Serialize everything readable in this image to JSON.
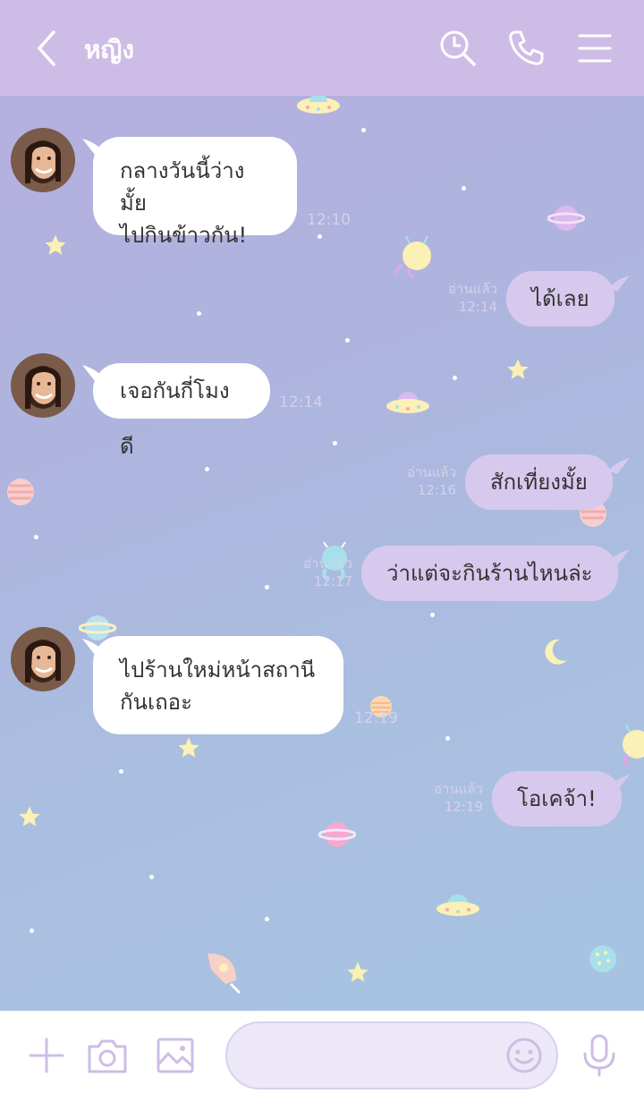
{
  "header": {
    "title": "หญิง"
  },
  "messages": [
    {
      "side": "in",
      "lines": [
        "กลางวันนี้ว่างมั้ย",
        "ไปกินข้าวกัน!"
      ],
      "time": "12:10"
    },
    {
      "side": "out",
      "text": "ได้เลย",
      "read": "อ่านแล้ว",
      "time": "12:14"
    },
    {
      "side": "in",
      "lines": [
        "เจอกันกี่โมงดี"
      ],
      "time": "12:14"
    },
    {
      "side": "out",
      "text": "สักเที่ยงมั้ย",
      "read": "อ่านแล้ว",
      "time": "12:16"
    },
    {
      "side": "out",
      "text": "ว่าแต่จะกินร้านไหนล่ะ",
      "read": "อ่านแล้ว",
      "time": "12:17"
    },
    {
      "side": "in",
      "lines": [
        "ไปร้านใหม่หน้าสถานี",
        "กันเถอะ"
      ],
      "time": "12:19"
    },
    {
      "side": "out",
      "text": "โอเคจ้า!",
      "read": "อ่านแล้ว",
      "time": "12:19"
    }
  ],
  "footer": {
    "icons": [
      "plus-icon",
      "camera-icon",
      "image-icon",
      "emoji-icon",
      "microphone-icon"
    ]
  },
  "colors": {
    "header": "#cdbde6",
    "outgoing_bubble": "#d7c9ee",
    "incoming_bubble": "#ffffff"
  }
}
